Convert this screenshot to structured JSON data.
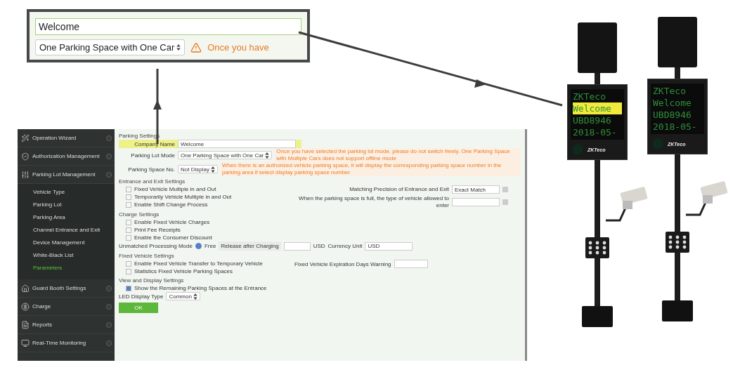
{
  "callout": {
    "company_name": "Welcome",
    "parking_lot_mode": "One Parking Space with One Car",
    "warning": "Once you have"
  },
  "sidebar": {
    "items": [
      {
        "label": "Operation Wizard",
        "kind": "wizard",
        "expanded": false
      },
      {
        "label": "Authorization Management",
        "kind": "authorization",
        "expanded": false
      },
      {
        "label": "Parking Lot Management",
        "kind": "parking",
        "expanded": true,
        "children": [
          {
            "label": "Vehicle Type",
            "selected": false
          },
          {
            "label": "Parking Lot",
            "selected": false
          },
          {
            "label": "Parking Area",
            "selected": false
          },
          {
            "label": "Channel Entrance and Exit",
            "selected": false
          },
          {
            "label": "Device Management",
            "selected": false
          },
          {
            "label": "White-Black List",
            "selected": false
          },
          {
            "label": "Parameters",
            "selected": true
          }
        ]
      },
      {
        "label": "Guard Booth Settings",
        "kind": "booth",
        "expanded": false
      },
      {
        "label": "Charge",
        "kind": "charge",
        "expanded": false
      },
      {
        "label": "Reports",
        "kind": "reports",
        "expanded": false
      },
      {
        "label": "Real-Time Monitoring",
        "kind": "monitoring",
        "expanded": false
      }
    ]
  },
  "parking_settings": {
    "title": "Parking Settings",
    "company_name": {
      "label": "Company Name",
      "value": "Welcome",
      "highlighted": true
    },
    "parking_lot_mode": {
      "label": "Parking Lot Mode",
      "value": "One Parking Space with One Car",
      "warning": "Once you have selected the parking lot mode, please do not switch freely. One Parking Space with Multiple Cars does not support offline mode"
    },
    "parking_space_no": {
      "label": "Parking Space No.",
      "value": "Not Display",
      "warning": "When there is an authorized vehicle parking space, it will display the corresponding parking space number in the parking area if select display parking space number"
    }
  },
  "entrance_exit": {
    "title": "Entrance and Exit Settings",
    "checkboxes": [
      {
        "label": "Fixed Vehicle Multiple in and Out",
        "checked": false
      },
      {
        "label": "Temporarily Vehicle Multiple in and Out",
        "checked": false
      },
      {
        "label": "Enable Shift Change Process",
        "checked": false
      }
    ],
    "matching_precision": {
      "label": "Matching Precision of Entrance and Exit",
      "value": "Exact Match"
    },
    "full_space_vehicle_type": {
      "label": "When the parking space is full, the type of vehicle allowed to enter"
    }
  },
  "charge": {
    "title": "Charge Settings",
    "checkboxes": [
      {
        "label": "Enable Fixed Vehicle Charges",
        "checked": false
      },
      {
        "label": "Print Fee Receipts",
        "checked": false
      },
      {
        "label": "Enable the Consumer Discount",
        "checked": false
      }
    ],
    "unmatched_mode": {
      "label": "Unmatched Processing Mode",
      "options": [
        {
          "label": "Free",
          "selected": true
        },
        {
          "label": "Release after Charging",
          "selected": false
        }
      ],
      "unit": "USD"
    },
    "currency_unit": {
      "label": "Currency Unit",
      "value": "USD"
    }
  },
  "fixed_vehicle": {
    "title": "Fixed Vehicle Settings",
    "checkboxes": [
      {
        "label": "Enable Fixed Vehicle Transfer to Temporary Vehicle",
        "checked": false
      },
      {
        "label": "Statistics Fixed Vehicle Parking Spaces",
        "checked": false
      }
    ],
    "expiration_warning": {
      "label": "Fixed Vehicle Expiration Days Warning"
    }
  },
  "view_display": {
    "title": "View and Display Settings",
    "checkboxes": [
      {
        "label": "Show the Remaining Parking Spaces at the Entrance",
        "checked": true
      }
    ],
    "led_display_type": {
      "label": "LED Display Type",
      "value": "Common"
    }
  },
  "ok_button": "OK",
  "devices": [
    {
      "brand": "ZKTeco",
      "screen_lines": [
        {
          "text": "ZKTeco",
          "highlighted": false
        },
        {
          "text": "Welcome",
          "highlighted": true
        },
        {
          "text": "UBD8946",
          "highlighted": false
        },
        {
          "text": "2018-05-",
          "highlighted": false
        }
      ]
    },
    {
      "brand": "ZKTeco",
      "screen_lines": [
        {
          "text": "ZKTeco",
          "highlighted": false
        },
        {
          "text": "Welcome",
          "highlighted": false
        },
        {
          "text": "UBD8946",
          "highlighted": false
        },
        {
          "text": "2018-05-",
          "highlighted": false
        }
      ]
    }
  ]
}
